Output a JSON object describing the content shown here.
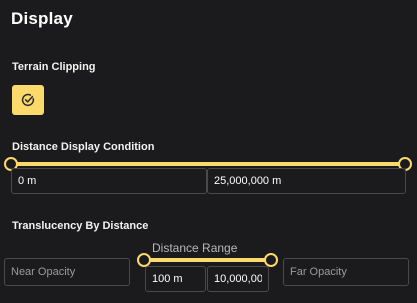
{
  "title": "Display",
  "terrain_clipping": {
    "label": "Terrain Clipping",
    "checked": true,
    "icon": "check-circle-icon"
  },
  "distance_display_condition": {
    "label": "Distance Display Condition",
    "near_value": "0 m",
    "far_value": "25,000,000 m"
  },
  "translucency_by_distance": {
    "label": "Translucency By Distance",
    "near_opacity_placeholder": "Near Opacity",
    "far_opacity_placeholder": "Far Opacity",
    "range_label": "Distance Range",
    "near_value": "100 m",
    "far_value": "10,000,00"
  },
  "colors": {
    "accent": "#fbd96a",
    "background": "#1b1b1d",
    "border": "#4a4a4e"
  }
}
